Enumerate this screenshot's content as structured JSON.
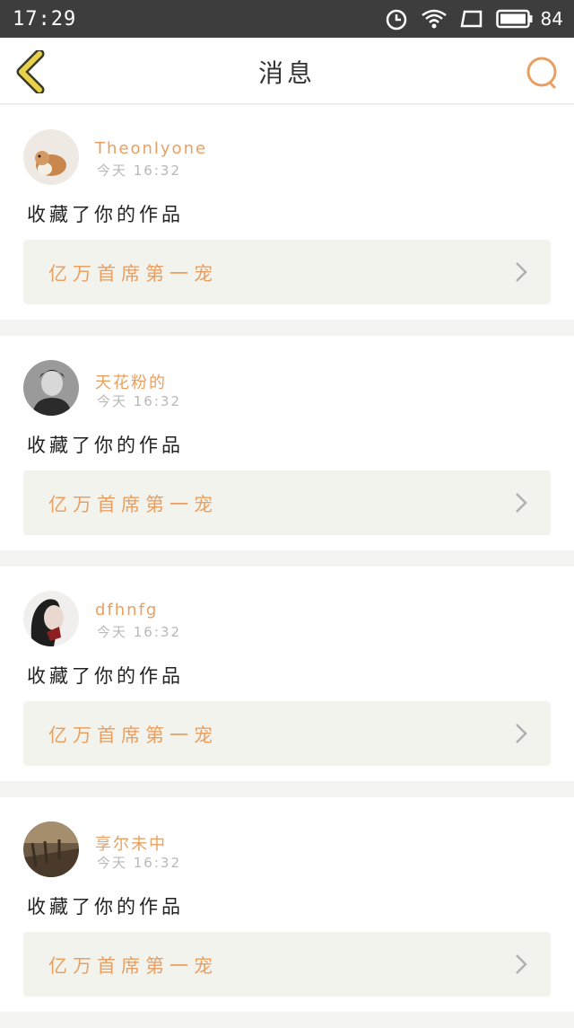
{
  "status_bar": {
    "time": "17:29",
    "battery": "84"
  },
  "header": {
    "title": "消息"
  },
  "colors": {
    "accent": "#e8a062",
    "back_icon": "#e8d24a"
  },
  "messages": [
    {
      "username": "Theonlyone",
      "time": "今天 16:32",
      "action": "收藏了你的作品",
      "work_title": "亿万首席第一宠",
      "avatar": "hamster-avatar"
    },
    {
      "username": "天花粉的",
      "time": "今天 16:32",
      "action": "收藏了你的作品",
      "work_title": "亿万首席第一宠",
      "avatar": "man-portrait-avatar"
    },
    {
      "username": "dfhnfg",
      "time": "今天 16:32",
      "action": "收藏了你的作品",
      "work_title": "亿万首席第一宠",
      "avatar": "woman-portrait-avatar"
    },
    {
      "username": "享尔未中",
      "time": "今天 16:32",
      "action": "收藏了你的作品",
      "work_title": "亿万首席第一宠",
      "avatar": "scenery-avatar"
    }
  ]
}
